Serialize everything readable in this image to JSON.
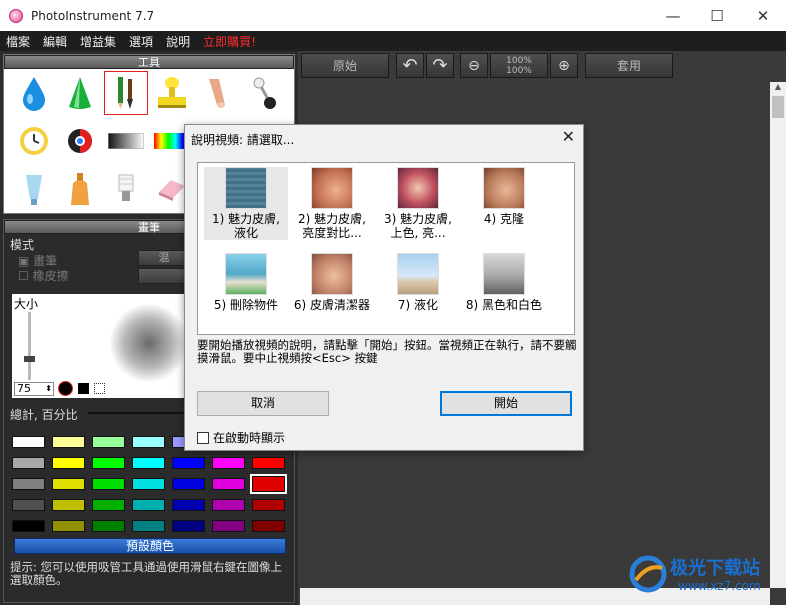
{
  "window": {
    "title": "PhotoInstrument 7.7",
    "minimize": "—",
    "maximize": "☐",
    "close": "✕"
  },
  "menu": [
    "檔案",
    "編輯",
    "增益集",
    "選項",
    "說明",
    "立即購買!"
  ],
  "tools_panel": {
    "title": "工具"
  },
  "brush_panel": {
    "title": "畫筆",
    "mode_label": "模式",
    "opt_brush": "畫筆",
    "opt_eraser": "橡皮擦",
    "btn_partial": "混",
    "size_label": "大小",
    "size_value": "75",
    "total_percent": "總計, 百分比",
    "preset_colors": "預設顏色",
    "tip": "提示: 您可以使用吸管工具通過使用滑鼠右鍵在圖像上選取顏色。"
  },
  "toolbar": {
    "original": "原始",
    "zoom_top": "100%",
    "zoom_bottom": "100%",
    "apply": "套用"
  },
  "dialog": {
    "title": "說明視頻: 請選取...",
    "close": "✕",
    "videos": [
      {
        "line1": "1) 魅力皮膚,",
        "line2": "液化"
      },
      {
        "line1": "2) 魅力皮膚,",
        "line2": "亮度對比..."
      },
      {
        "line1": "3) 魅力皮膚,",
        "line2": "上色, 亮..."
      },
      {
        "line1": "4) 克隆",
        "line2": ""
      },
      {
        "line1": "5) 刪除物件",
        "line2": ""
      },
      {
        "line1": "6) 皮膚清潔器",
        "line2": ""
      },
      {
        "line1": "7) 液化",
        "line2": ""
      },
      {
        "line1": "8) 黑色和白色",
        "line2": ""
      }
    ],
    "message": "要開始播放視頻的說明，請點擊「開始」按鈕。當視頻正在執行，請不要觸摸滑鼠。要中止視頻按<Esc> 按鍵",
    "cancel": "取消",
    "start": "開始",
    "show_on_start": "在啟動時顯示"
  },
  "watermark": {
    "brand": "极光下载站",
    "url": "www.xz7.com"
  },
  "colors": {
    "rows": [
      [
        "#ffffff",
        "#ffff9a",
        "#9aff9a",
        "#9affff",
        "#9a9aff",
        "#ff9aff",
        "#ff9a9a"
      ],
      [
        "#a8a8a8",
        "#ffff00",
        "#00ff00",
        "#00ffff",
        "#0000ff",
        "#ff00ff",
        "#ff0000"
      ],
      [
        "#808080",
        "#e0e000",
        "#00e000",
        "#00e0e0",
        "#0000e0",
        "#e000e0",
        "#e00000"
      ],
      [
        "#505050",
        "#c0c000",
        "#00b000",
        "#00b0b0",
        "#0000b0",
        "#b000b0",
        "#b00000"
      ],
      [
        "#000000",
        "#909000",
        "#008000",
        "#008080",
        "#000080",
        "#800080",
        "#800000"
      ]
    ]
  }
}
